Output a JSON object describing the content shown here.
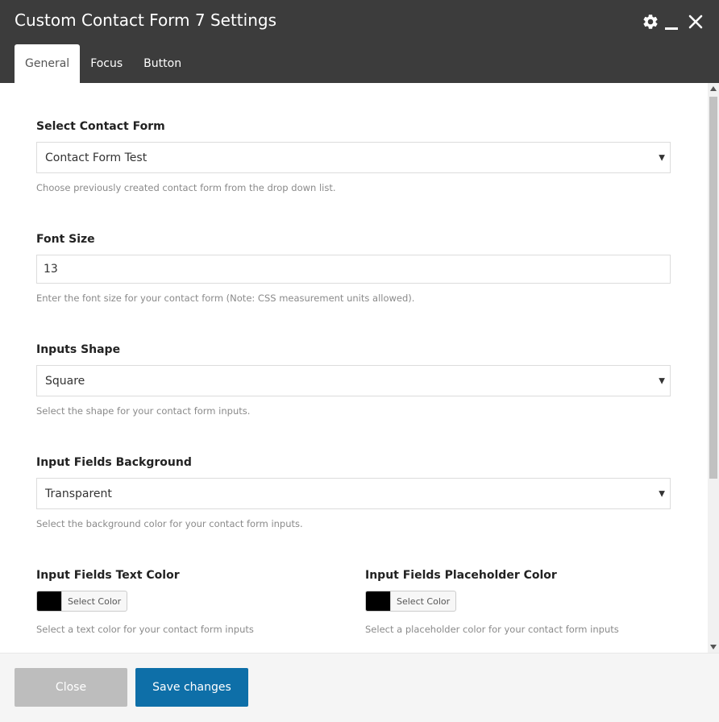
{
  "window": {
    "title": "Custom Contact Form 7 Settings",
    "controls": [
      "gear-icon",
      "minimize-icon",
      "close-icon"
    ]
  },
  "tabs": [
    {
      "label": "General",
      "active": true
    },
    {
      "label": "Focus",
      "active": false
    },
    {
      "label": "Button",
      "active": false
    }
  ],
  "fields": {
    "contact_form": {
      "label": "Select Contact Form",
      "value": "Contact Form Test",
      "help": "Choose previously created contact form from the drop down list."
    },
    "font_size": {
      "label": "Font Size",
      "value": "13",
      "help": "Enter the font size for your contact form (Note: CSS measurement units allowed)."
    },
    "inputs_shape": {
      "label": "Inputs Shape",
      "value": "Square",
      "help": "Select the shape for your contact form inputs."
    },
    "input_background": {
      "label": "Input Fields Background",
      "value": "Transparent",
      "help": "Select the background color for your contact form inputs."
    },
    "text_color": {
      "label": "Input Fields Text Color",
      "button_label": "Select Color",
      "swatch_color": "#000000",
      "help": "Select a text color for your contact form inputs"
    },
    "placeholder_color": {
      "label": "Input Fields Placeholder Color",
      "button_label": "Select Color",
      "swatch_color": "#000000",
      "help": "Select a placeholder color for your contact form inputs"
    }
  },
  "footer": {
    "close_label": "Close",
    "save_label": "Save changes"
  },
  "colors": {
    "header_bg": "#3c3c3c",
    "primary_button": "#0e6fa8",
    "disabled_button": "#bdbdbd"
  }
}
